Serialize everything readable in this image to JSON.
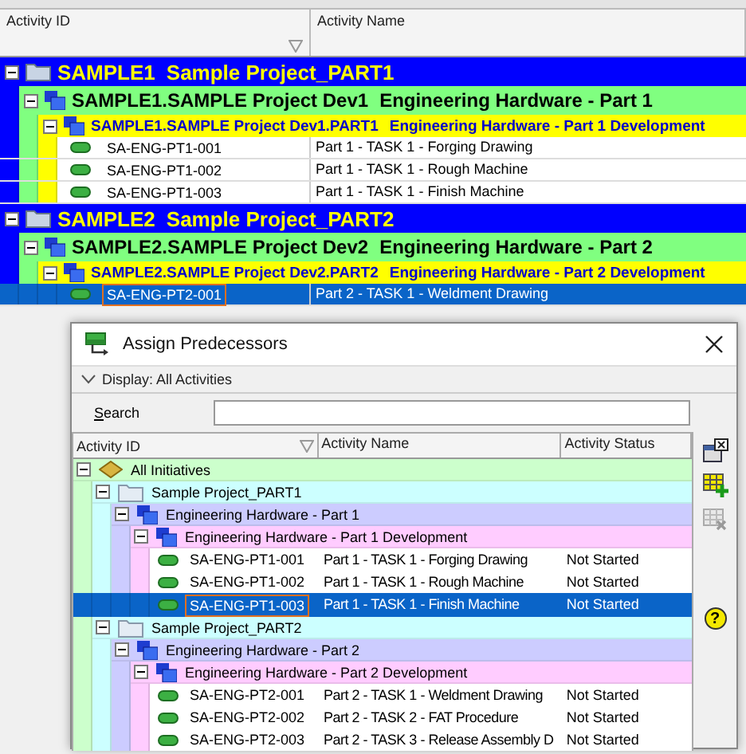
{
  "grid": {
    "columns": [
      "Activity ID",
      "Activity Name"
    ],
    "nodes": [
      {
        "kind": "project",
        "code": "SAMPLE1",
        "name": "Sample Project_PART1",
        "expanded": true,
        "children": [
          {
            "kind": "wbs",
            "code": "SAMPLE1.SAMPLE Project Dev1",
            "name": "Engineering Hardware - Part 1",
            "expanded": true,
            "children": [
              {
                "kind": "wbs",
                "code": "SAMPLE1.SAMPLE Project Dev1.PART1",
                "name": "Engineering Hardware - Part 1 Development",
                "expanded": true,
                "children": [
                  {
                    "kind": "activity",
                    "id": "SA-ENG-PT1-001",
                    "name": "Part 1 - TASK 1 - Forging Drawing",
                    "selected": false
                  },
                  {
                    "kind": "activity",
                    "id": "SA-ENG-PT1-002",
                    "name": "Part 1 - TASK 1 - Rough Machine",
                    "selected": false
                  },
                  {
                    "kind": "activity",
                    "id": "SA-ENG-PT1-003",
                    "name": "Part 1 - TASK 1 - Finish Machine",
                    "selected": false
                  }
                ]
              }
            ]
          }
        ]
      },
      {
        "kind": "project",
        "code": "SAMPLE2",
        "name": "Sample Project_PART2",
        "expanded": true,
        "children": [
          {
            "kind": "wbs",
            "code": "SAMPLE2.SAMPLE Project Dev2",
            "name": "Engineering Hardware - Part 2",
            "expanded": true,
            "children": [
              {
                "kind": "wbs",
                "code": "SAMPLE2.SAMPLE Project Dev2.PART2",
                "name": "Engineering Hardware - Part 2 Development",
                "expanded": true,
                "children": [
                  {
                    "kind": "activity",
                    "id": "SA-ENG-PT2-001",
                    "name": "Part 2 - TASK 1 - Weldment Drawing",
                    "selected": true
                  }
                ]
              }
            ]
          }
        ]
      }
    ]
  },
  "dialog": {
    "title": "Assign Predecessors",
    "display": "Display: All Activities",
    "search": {
      "label": "Search"
    },
    "columns": [
      "Activity ID",
      "Activity Name",
      "Activity Status"
    ],
    "nodes": [
      {
        "kind": "initiative",
        "name": "All Initiatives",
        "expanded": true,
        "children": [
          {
            "kind": "project",
            "name": "Sample Project_PART1",
            "expanded": true,
            "children": [
              {
                "kind": "wbs",
                "name": "Engineering Hardware - Part 1",
                "expanded": true,
                "children": [
                  {
                    "kind": "wbs",
                    "name": "Engineering Hardware - Part 1 Development",
                    "expanded": true,
                    "children": [
                      {
                        "kind": "activity",
                        "id": "SA-ENG-PT1-001",
                        "name": "Part 1 - TASK 1 - Forging Drawing",
                        "status": "Not Started",
                        "selected": false
                      },
                      {
                        "kind": "activity",
                        "id": "SA-ENG-PT1-002",
                        "name": "Part 1 - TASK 1 - Rough Machine",
                        "status": "Not Started",
                        "selected": false
                      },
                      {
                        "kind": "activity",
                        "id": "SA-ENG-PT1-003",
                        "name": "Part 1 - TASK 1 - Finish Machine",
                        "status": "Not Started",
                        "selected": true
                      }
                    ]
                  }
                ]
              }
            ]
          },
          {
            "kind": "project",
            "name": "Sample Project_PART2",
            "expanded": true,
            "children": [
              {
                "kind": "wbs",
                "name": "Engineering Hardware - Part 2",
                "expanded": true,
                "children": [
                  {
                    "kind": "wbs",
                    "name": "Engineering Hardware - Part 2 Development",
                    "expanded": true,
                    "children": [
                      {
                        "kind": "activity",
                        "id": "SA-ENG-PT2-001",
                        "name": "Part 2 - TASK 1 - Weldment Drawing",
                        "status": "Not Started",
                        "selected": false
                      },
                      {
                        "kind": "activity",
                        "id": "SA-ENG-PT2-002",
                        "name": "Part 2 - TASK 2 - FAT Procedure",
                        "status": "Not Started",
                        "selected": false
                      },
                      {
                        "kind": "activity",
                        "id": "SA-ENG-PT2-003",
                        "name": "Part 2 - TASK 3 - Release Assembly D",
                        "status": "Not Started",
                        "selected": false
                      }
                    ]
                  }
                ]
              }
            ]
          }
        ]
      }
    ],
    "tools": [
      {
        "kind": "close-window",
        "disabled": false
      },
      {
        "kind": "add",
        "disabled": false
      },
      {
        "kind": "remove",
        "disabled": true
      },
      {
        "kind": "help",
        "glyph": "?",
        "disabled": false
      }
    ]
  }
}
